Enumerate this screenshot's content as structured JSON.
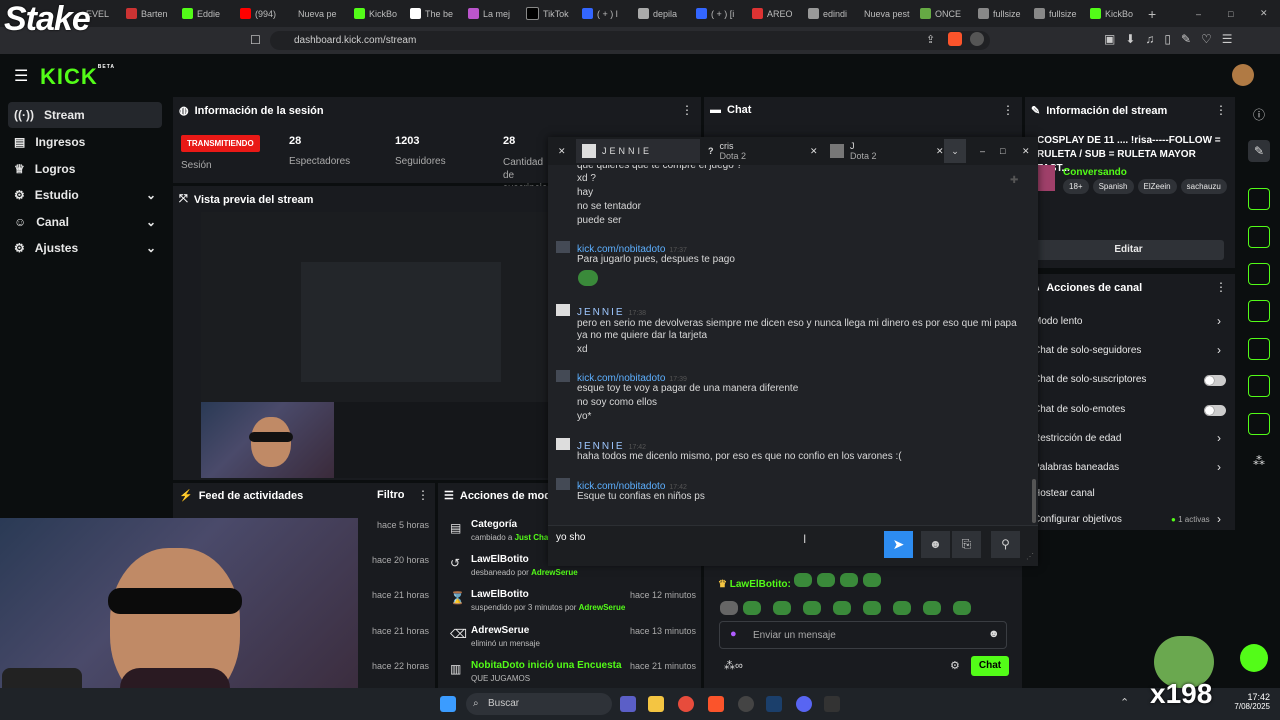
{
  "browser": {
    "tabs": [
      "EVEL",
      "Barten",
      "Eddie",
      "(994)",
      "Nueva pe",
      "KickBo",
      "The be",
      "La mej",
      "TikTok",
      "( + ) l",
      "depila",
      "( + ) [i",
      "AREO",
      "edindi",
      "Nueva pest",
      "ONCE",
      "fullsize",
      "fullsize",
      "KickBo"
    ],
    "url": "dashboard.kick.com/stream",
    "overlay_logo": "Stake"
  },
  "kick": {
    "logo": "KICK",
    "logo_badge": "BETA",
    "sidebar": {
      "items": [
        {
          "label": "Stream",
          "icon": "broadcast-icon"
        },
        {
          "label": "Ingresos",
          "icon": "wallet-icon"
        },
        {
          "label": "Logros",
          "icon": "trophy-icon"
        },
        {
          "label": "Estudio",
          "icon": "gear-icon"
        },
        {
          "label": "Canal",
          "icon": "people-icon"
        },
        {
          "label": "Ajustes",
          "icon": "settings-icon"
        }
      ]
    },
    "session": {
      "title": "Información de la sesión",
      "live_badge": "TRANSMITIENDO",
      "session_label": "Sesión",
      "stats": [
        {
          "num": "28",
          "label": "Espectadores"
        },
        {
          "num": "1203",
          "label": "Seguidores"
        },
        {
          "num": "28",
          "label": "Cantidad de suscripciones"
        }
      ]
    },
    "preview": {
      "title": "Vista previa del stream"
    },
    "feed": {
      "title": "Feed de actividades",
      "filter": "Filtro",
      "times": [
        "hace 5 horas",
        "hace 20 horas",
        "hace 21 horas",
        "hace 21 horas",
        "hace 22 horas"
      ]
    },
    "modlog": {
      "title": "Acciones de moderación",
      "items": [
        {
          "title": "Categoría",
          "sub_prefix": "cambiado a ",
          "sub_accent": "Just Chatting",
          "time": ""
        },
        {
          "title": "LawElBotito",
          "sub_prefix": "desbaneado por ",
          "sub_accent": "AdrewSerue",
          "time": "hace 12 minutos"
        },
        {
          "title": "LawElBotito",
          "sub_prefix": "suspendido por 3 minutos por ",
          "sub_accent": "AdrewSerue",
          "time": ""
        },
        {
          "title": "AdrewSerue",
          "sub_prefix": "eliminó un mensaje",
          "sub_accent": "",
          "time": "hace 13 minutos"
        },
        {
          "title": "NobitaDoto inició una Encuesta",
          "sub_prefix": "QUE JUGAMOS",
          "sub_accent": "",
          "time": "hace 21 minutos"
        }
      ]
    },
    "chat": {
      "title": "Chat",
      "line_user": "LawElBotito:",
      "input_placeholder": "Enviar un mensaje",
      "send_label": "Chat"
    },
    "stream_info": {
      "title": "Información del stream",
      "stream_title": "COSPLAY DE 11 .... !risa-----FOLLOW = RULETA / SUB = RULETA MAYOR FAST...",
      "category": "Conversando",
      "tags": [
        "18+",
        "Spanish",
        "ElZeein",
        "sachauzu"
      ],
      "edit": "Editar"
    },
    "channel_actions": {
      "title": "Acciones de canal",
      "items": [
        {
          "label": "Modo lento",
          "control": "chevron"
        },
        {
          "label": "Chat de solo-seguidores",
          "control": "chevron"
        },
        {
          "label": "Chat de solo-suscriptores",
          "control": "toggle"
        },
        {
          "label": "Chat de solo-emotes",
          "control": "toggle"
        },
        {
          "label": "Restricción de edad",
          "control": "chevron"
        },
        {
          "label": "Palabras baneadas",
          "control": "chevron"
        },
        {
          "label": "Hostear canal",
          "control": "none"
        },
        {
          "label": "Configurar objetivos",
          "control": "chevron",
          "badge": "1 activas"
        }
      ]
    }
  },
  "popup": {
    "tabs": [
      {
        "name": "JENNIE",
        "sub": ""
      },
      {
        "name": "cris",
        "sub": "Dota 2"
      },
      {
        "name": "J",
        "sub": "Dota 2"
      }
    ],
    "top_lines": [
      "que quieres que te compre el juego ?",
      "xd ?",
      "hay",
      "no se tentador",
      "puede ser"
    ],
    "messages": [
      {
        "author": "kick.com/nobitadoto",
        "time": "17:37",
        "lines": [
          "Para jugarlo pues, despues te pago"
        ],
        "type": "n"
      },
      {
        "author": "JENNIE",
        "time": "17:38",
        "lines": [
          "pero en serio me devolveras siempre me dicen eso y nunca llega mi dinero es por eso que mi papa",
          "ya no me quiere dar la tarjeta",
          "xd"
        ],
        "type": "j"
      },
      {
        "author": "kick.com/nobitadoto",
        "time": "17:39",
        "lines": [
          "esque toy te voy a pagar de una manera diferente",
          "no soy como ellos",
          "yo*"
        ],
        "type": "n"
      },
      {
        "author": "JENNIE",
        "time": "17:42",
        "lines": [
          "haha todos me dicenlo mismo, por eso es que no confio en los varones :("
        ],
        "type": "j"
      },
      {
        "author": "kick.com/nobitadoto",
        "time": "17:42",
        "lines": [
          "Esque tu confias en niños ps"
        ],
        "type": "n"
      }
    ],
    "input_value": "yo sho"
  },
  "taskbar": {
    "search": "Buscar",
    "time": "17:42",
    "date": "7/08/2025"
  },
  "overlay": {
    "watermark": "x198"
  },
  "colors": {
    "kick_green": "#53fc18",
    "live_red": "#e91916",
    "panel": "#191b1f",
    "send_blue": "#2d8cf0"
  }
}
